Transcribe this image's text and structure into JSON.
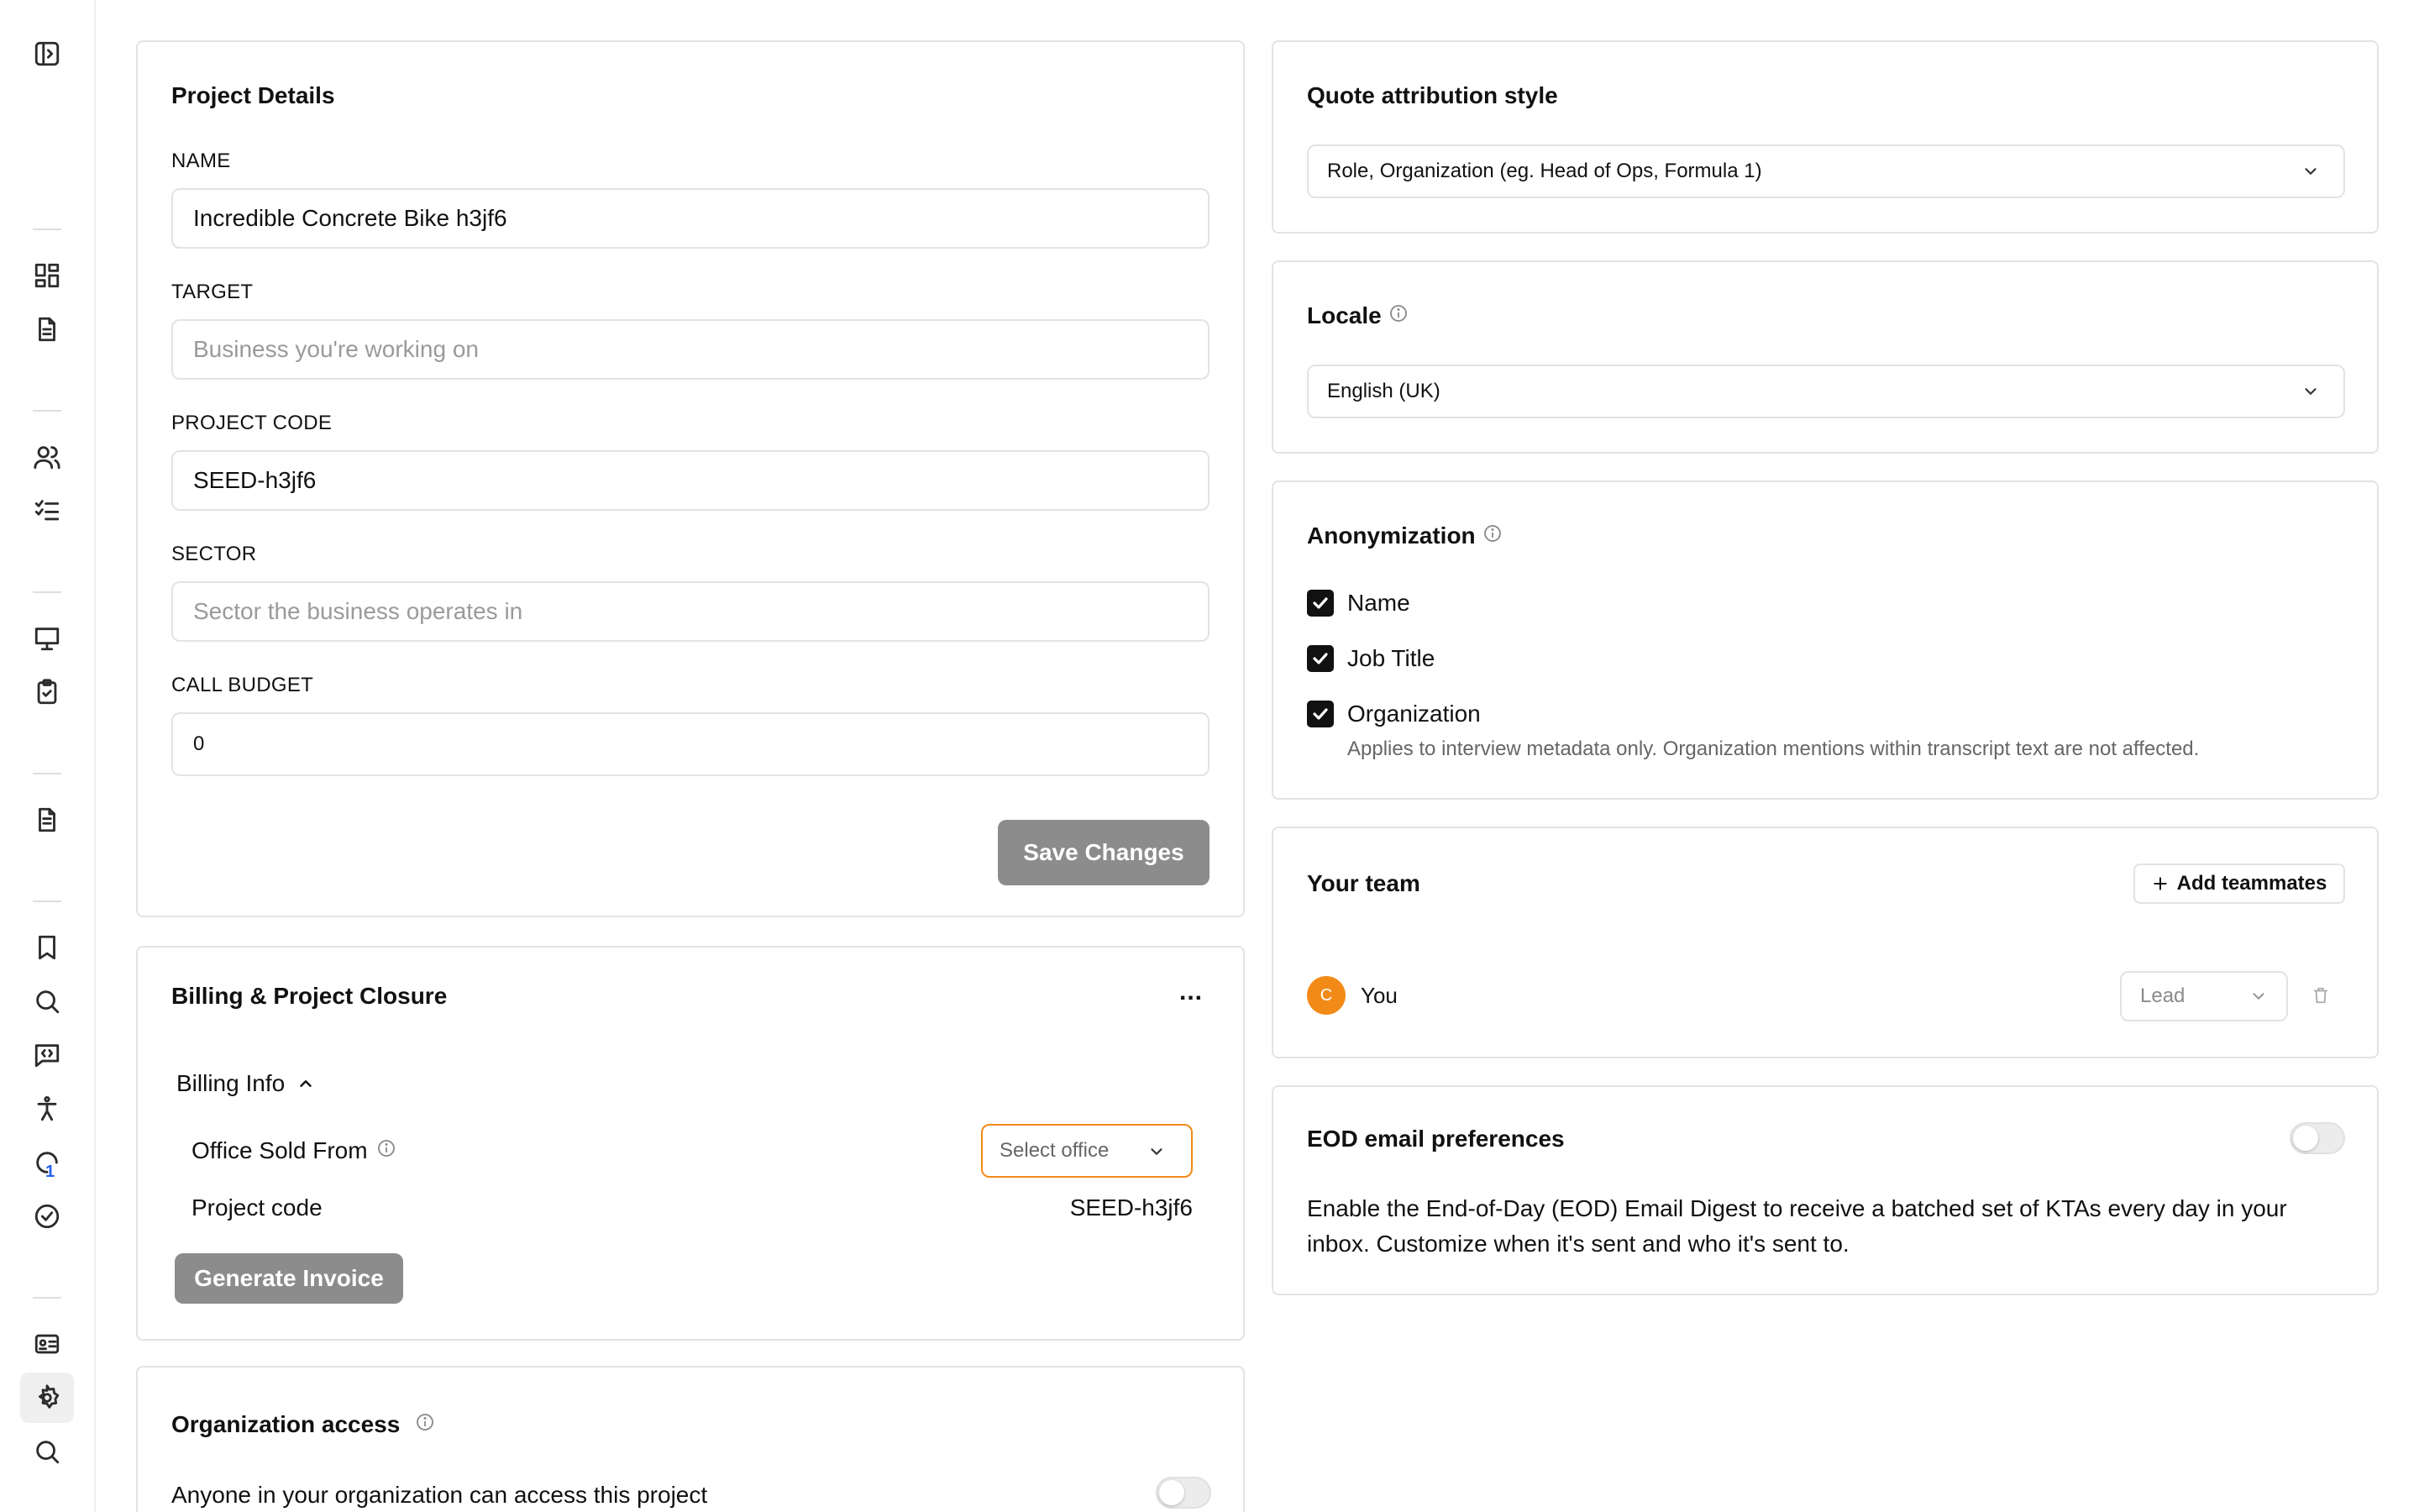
{
  "sidebar": {
    "icons": [
      "sidebar-toggle-icon",
      "dashboard-icon",
      "document-icon",
      "users-icon",
      "checklist-icon",
      "presentation-icon",
      "clipboard-check-icon",
      "file-text-icon",
      "bookmark-icon",
      "search-icon",
      "code-chat-icon",
      "accessibility-icon",
      "progress-icon",
      "check-circle-icon",
      "id-card-icon",
      "gear-icon",
      "search-icon"
    ],
    "badge": "1"
  },
  "project_details": {
    "title": "Project Details",
    "name_label": "NAME",
    "name_value": "Incredible Concrete Bike h3jf6",
    "target_label": "TARGET",
    "target_placeholder": "Business you're working on",
    "code_label": "PROJECT CODE",
    "code_value": "SEED-h3jf6",
    "sector_label": "SECTOR",
    "sector_placeholder": "Sector the business operates in",
    "budget_label": "CALL BUDGET",
    "budget_value": "0",
    "save_label": "Save Changes"
  },
  "billing": {
    "title": "Billing & Project Closure",
    "menu": "...",
    "info_label": "Billing Info",
    "office_label": "Office Sold From",
    "office_placeholder": "Select office",
    "project_code_label": "Project code",
    "project_code_value": "SEED-h3jf6",
    "generate_label": "Generate Invoice"
  },
  "org_access": {
    "title": "Organization access",
    "description": "Anyone in your organization can access this project"
  },
  "quote": {
    "title": "Quote attribution style",
    "selected": "Role, Organization (eg. Head of Ops, Formula 1)"
  },
  "locale": {
    "title": "Locale",
    "selected": "English (UK)"
  },
  "anonymization": {
    "title": "Anonymization",
    "options": [
      "Name",
      "Job Title",
      "Organization"
    ],
    "note": "Applies to interview metadata only. Organization mentions within transcript text are not affected."
  },
  "team": {
    "title": "Your team",
    "add_label": "Add teammates",
    "member_initial": "C",
    "member_name": "You",
    "member_role": "Lead",
    "avatar_color": "#f28a17"
  },
  "eod": {
    "title": "EOD email preferences",
    "description_line1": "Enable the End-of-Day (EOD) Email Digest to receive a batched set of KTAs every day in your",
    "description_line2": "inbox. Customize when it's sent and who it's sent to."
  },
  "colors": {
    "accent_orange": "#f28a17",
    "button_gray": "#8c8c8c",
    "border": "#e3e3e3"
  }
}
